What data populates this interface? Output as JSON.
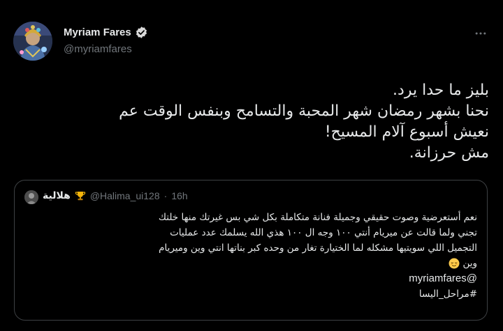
{
  "author": {
    "name": "Myriam Fares",
    "handle": "@myriamfares",
    "verified": true
  },
  "tweet": {
    "lines": [
      "بليز ما حدا يرد.",
      "نحنا بشهر رمضان شهر المحبة والتسامح وبنفس الوقت عم",
      "نعيش أسبوع آلام المسيح!",
      "مش حرزانة."
    ]
  },
  "quote": {
    "name": "هلالية",
    "badge_icon": "trophy-emoji",
    "handle": "@Halima_ui128",
    "dot": "·",
    "time": "16h",
    "lines": [
      "نعم أستعرضية وصوت حقيقي وجميلة فنانة متكاملة بكل شي بس غيرتك منها خلتك",
      "تجني ولما قالت عن ميريام أنتي ١٠٠ وجه ال ١٠٠ هذي الله يسلمك عدد عمليات",
      "التجميل اللي سويتيها مشكله لما الختيارة تغار من وحده كبر بناتها  انتي وين وميريام",
      "وين"
    ],
    "mention": "@myriamfares",
    "hashtag": "#مراحل_اليسا"
  },
  "colors": {
    "background": "#000000",
    "text": "#e7e9ea",
    "secondary": "#71767b",
    "border": "#3e4144",
    "verified_badge": "#d9d9d9"
  }
}
